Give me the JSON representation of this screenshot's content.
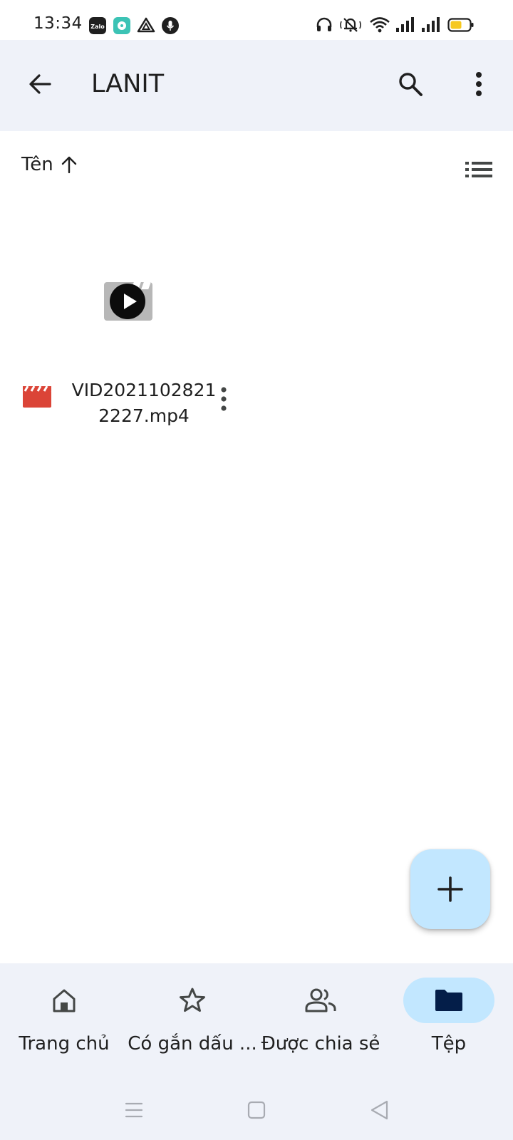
{
  "status_bar": {
    "time": "13:34",
    "left_icons": [
      "zalo-app-icon",
      "music-app-icon",
      "drive-app-icon",
      "microphone-icon"
    ],
    "zalo_label": "Zalo",
    "right_icons": [
      "headset-icon",
      "muted-bell-icon",
      "wifi-icon",
      "signal-icon",
      "signal-icon",
      "battery-icon"
    ],
    "battery_color": "#f6c81e"
  },
  "app_bar": {
    "title": "LANIT",
    "background": "#eff2f9"
  },
  "sort": {
    "label": "Tên",
    "direction_icon": "arrow-up-icon"
  },
  "files": [
    {
      "name": "VID20211028212227.mp4",
      "type_icon": "movie-icon",
      "type_color": "#db4437"
    }
  ],
  "fab": {
    "icon": "plus-icon",
    "background": "#c2e7ff"
  },
  "bottom_nav": {
    "items": [
      {
        "label": "Trang chủ",
        "icon": "home-icon",
        "active": false
      },
      {
        "label": "Có gắn dấu ...",
        "icon": "star-icon",
        "active": false
      },
      {
        "label": "Được chia sẻ",
        "icon": "people-icon",
        "active": false
      },
      {
        "label": "Tệp",
        "icon": "folder-icon",
        "active": true
      }
    ],
    "active_pill_color": "#c2e7ff"
  },
  "system_nav": [
    "menu-icon",
    "home-square-icon",
    "back-triangle-icon"
  ]
}
